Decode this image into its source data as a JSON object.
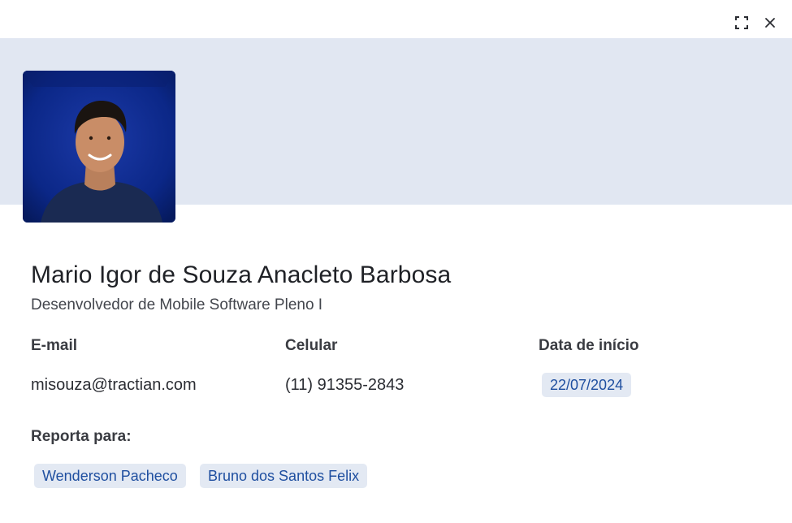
{
  "window": {
    "expand_icon": "expand-icon",
    "close_icon": "close-icon"
  },
  "colors": {
    "cover": "#e1e7f2",
    "chip_bg": "#e3e9f3",
    "chip_text": "#1f4fa0",
    "avatar_bg": "#0a2a8a"
  },
  "profile": {
    "avatar": "profile-photo",
    "name": "Mario Igor de Souza Anacleto Barbosa",
    "role": "Desenvolvedor de Mobile Software Pleno I"
  },
  "fields": {
    "email_label": "E-mail",
    "email_value": "misouza@tractian.com",
    "phone_label": "Celular",
    "phone_value": "(11) 91355-2843",
    "start_label": "Data de início",
    "start_value": "22/07/2024"
  },
  "reports_to": {
    "label": "Reporta para:",
    "people": [
      "Wenderson Pacheco",
      "Bruno dos Santos Felix"
    ]
  }
}
